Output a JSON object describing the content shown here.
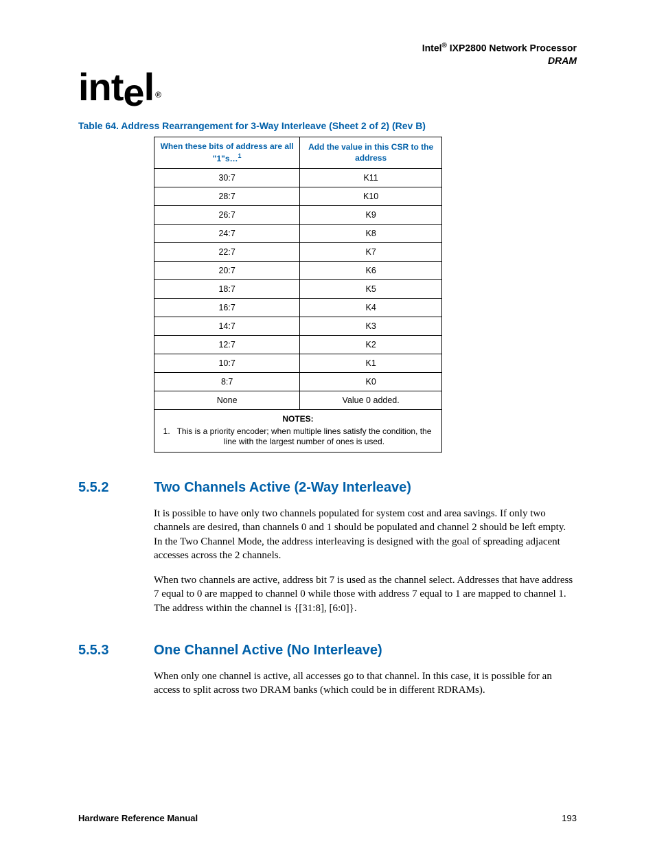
{
  "header": {
    "brand": "Intel",
    "reg": "®",
    "product": "IXP2800 Network Processor",
    "subtitle": "DRAM"
  },
  "logo": {
    "text_a": "int",
    "text_b": "e",
    "text_c": "l",
    "reg": "®"
  },
  "table": {
    "caption": "Table 64.  Address Rearrangement for 3-Way Interleave (Sheet 2 of 2)  (Rev B)",
    "col1": "When these bits of address are all \"1\"s…",
    "col1_sup": "1",
    "col2": "Add the value in this CSR to the address",
    "rows": [
      {
        "a": "30:7",
        "b": "K11"
      },
      {
        "a": "28:7",
        "b": "K10"
      },
      {
        "a": "26:7",
        "b": "K9"
      },
      {
        "a": "24:7",
        "b": "K8"
      },
      {
        "a": "22:7",
        "b": "K7"
      },
      {
        "a": "20:7",
        "b": "K6"
      },
      {
        "a": "18:7",
        "b": "K5"
      },
      {
        "a": "16:7",
        "b": "K4"
      },
      {
        "a": "14:7",
        "b": "K3"
      },
      {
        "a": "12:7",
        "b": "K2"
      },
      {
        "a": "10:7",
        "b": "K1"
      },
      {
        "a": "8:7",
        "b": "K0"
      },
      {
        "a": "None",
        "b": "Value 0 added."
      }
    ],
    "notes_label": "NOTES:",
    "notes": [
      "This is a priority encoder; when multiple lines satisfy the condition, the line with the largest number of ones is used."
    ]
  },
  "sections": [
    {
      "num": "5.5.2",
      "title": "Two Channels Active (2-Way Interleave)",
      "paragraphs": [
        "It is possible to have only two channels populated for system cost and area savings. If only two channels are desired, than channels 0 and 1 should be populated and channel 2 should be left empty. In the Two Channel Mode, the address interleaving is designed with the goal of spreading adjacent accesses across the 2 channels.",
        "When two channels are active, address bit 7 is used as the channel select. Addresses that have address 7 equal to 0 are mapped to channel 0 while those with address 7 equal to 1 are mapped to channel 1. The address within the channel is {[31:8], [6:0]}."
      ]
    },
    {
      "num": "5.5.3",
      "title": "One Channel Active (No Interleave)",
      "paragraphs": [
        "When only one channel is active, all accesses go to that channel. In this case, it is possible for an access to split across two DRAM banks (which could be in different RDRAMs)."
      ]
    }
  ],
  "footer": {
    "left": "Hardware Reference Manual",
    "right": "193"
  }
}
